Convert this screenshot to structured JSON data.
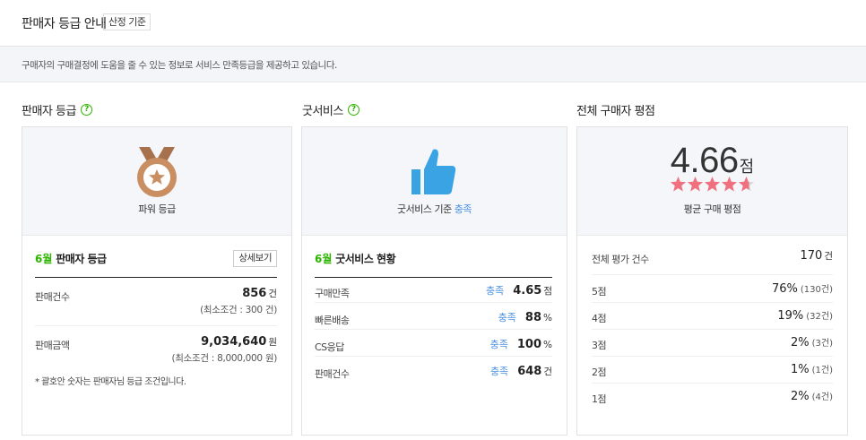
{
  "header": {
    "title": "판매자 등급 안내",
    "badge": "산정 기준"
  },
  "notice": "구매자의 구매결정에 도움을 줄 수 있는 정보로 서비스 만족등급을 제공하고 있습니다.",
  "sections": {
    "seller_grade": "판매자 등급",
    "good_service": "굿서비스",
    "rating": "전체 구매자 평점"
  },
  "seller": {
    "grade_name": "파워 등급",
    "month": "6월",
    "grade_heading": "판매자 등급",
    "detail_button": "상세보기",
    "sales_count_label": "판매건수",
    "sales_count_value": "856",
    "sales_count_unit": "건",
    "sales_count_min": "(최소조건 : 300 건)",
    "sales_amount_label": "판매금액",
    "sales_amount_value": "9,034,640",
    "sales_amount_unit": "원",
    "sales_amount_min": "(최소조건 : 8,000,000 원)",
    "note": "* 괄호안 숫자는 판매자님 등급 조건입니다."
  },
  "goodservice": {
    "criteria_prefix": "굿서비스 기준",
    "criteria_status": "충족",
    "month": "6월",
    "heading": "굿서비스 현황",
    "rows": [
      {
        "label": "구매만족",
        "status": "충족",
        "value": "4.65",
        "unit": "점"
      },
      {
        "label": "빠른배송",
        "status": "충족",
        "value": "88",
        "unit": "%"
      },
      {
        "label": "CS응답",
        "status": "충족",
        "value": "100",
        "unit": "%"
      },
      {
        "label": "판매건수",
        "status": "충족",
        "value": "648",
        "unit": "건"
      }
    ]
  },
  "rating": {
    "score": "4.66",
    "score_unit": "점",
    "stars_filled": 4.66,
    "stars_max": 5,
    "score_label": "평균 구매 평점",
    "total_label": "전체 평가 건수",
    "total_value": "170",
    "total_unit": "건",
    "rows": [
      {
        "label": "5점",
        "pct": "76%",
        "count": "(130건)"
      },
      {
        "label": "4점",
        "pct": "19%",
        "count": "(32건)"
      },
      {
        "label": "3점",
        "pct": "2%",
        "count": "(3건)"
      },
      {
        "label": "2점",
        "pct": "1%",
        "count": "(1건)"
      },
      {
        "label": "1점",
        "pct": "2%",
        "count": "(4건)"
      }
    ]
  },
  "colors": {
    "green": "#2db400",
    "blue_status": "#4a90e2",
    "thumb": "#3aa3e3",
    "medal": "#c98f63",
    "star": "#f0707f"
  }
}
